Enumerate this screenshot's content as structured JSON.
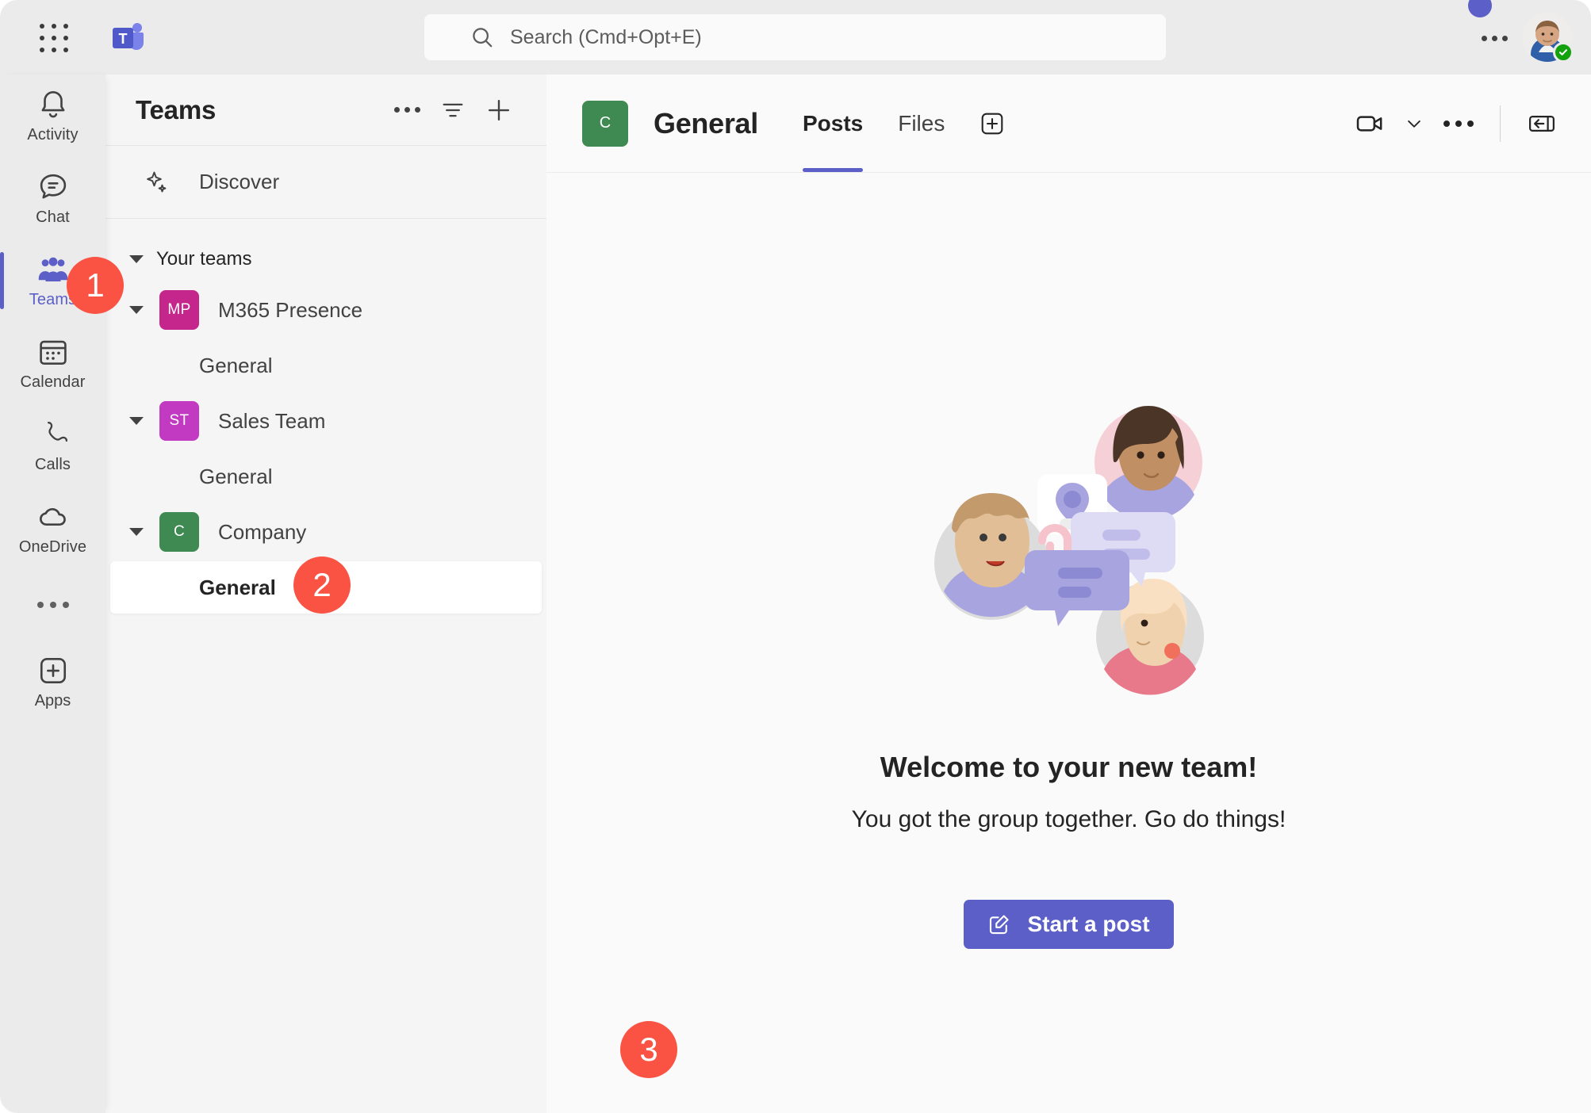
{
  "topbar": {
    "waffle_label": "app-launcher",
    "logo_label": "Microsoft Teams",
    "search": {
      "placeholder": "Search (Cmd+Opt+E)",
      "value": "",
      "icon": "search-icon"
    },
    "more_label": "Settings and more",
    "avatar_label": "Account manager",
    "presence_status": "Available"
  },
  "rail": {
    "items": [
      {
        "label": "Activity",
        "icon": "bell-icon",
        "active": false
      },
      {
        "label": "Chat",
        "icon": "chat-icon",
        "active": false
      },
      {
        "label": "Teams",
        "icon": "teams-icon",
        "active": true
      },
      {
        "label": "Calendar",
        "icon": "calendar-icon",
        "active": false
      },
      {
        "label": "Calls",
        "icon": "phone-icon",
        "active": false
      },
      {
        "label": "OneDrive",
        "icon": "cloud-icon",
        "active": false
      }
    ],
    "more_label": "More apps",
    "apps_label": "Apps"
  },
  "teams_panel": {
    "title": "Teams",
    "more_label": "Teams options",
    "filter_label": "Filter",
    "add_label": "Join or create a team",
    "discover_label": "Discover",
    "your_teams_label": "Your teams",
    "teams": [
      {
        "name": "M365 Presence",
        "initials": "MP",
        "color": "#C4268C",
        "expanded": true,
        "channels": [
          {
            "name": "General",
            "selected": false
          }
        ]
      },
      {
        "name": "Sales Team",
        "initials": "ST",
        "color": "#C239C2",
        "expanded": true,
        "channels": [
          {
            "name": "General",
            "selected": false
          }
        ]
      },
      {
        "name": "Company",
        "initials": "C",
        "color": "#3E8A52",
        "expanded": true,
        "channels": [
          {
            "name": "General",
            "selected": true
          }
        ]
      }
    ]
  },
  "channel": {
    "team_initials": "C",
    "team_color": "#3E8A52",
    "title": "General",
    "tabs": [
      {
        "label": "Posts",
        "active": true
      },
      {
        "label": "Files",
        "active": false
      }
    ],
    "add_tab_label": "Add a tab",
    "meet_label": "Meet now",
    "meet_chevron_label": "Meeting options",
    "more_label": "More options",
    "expand_label": "Open chat details"
  },
  "empty_state": {
    "illustration": "team-collaboration-illustration",
    "title": "Welcome to your new team!",
    "subtitle": "You got the group together. Go do things!",
    "start_post_label": "Start a post",
    "start_post_icon": "compose-icon"
  },
  "step_badges": [
    {
      "number": "1",
      "target": "rail-item-teams"
    },
    {
      "number": "2",
      "target": "channel-general-company"
    },
    {
      "number": "3",
      "target": "start-a-post-button"
    }
  ],
  "colors": {
    "accent": "#5B5FC7",
    "badge": "#FA5343",
    "presence_available": "#13A10E",
    "rail_bg": "#EBEBEB",
    "panel_bg": "#F5F5F5",
    "main_bg": "#FAFAFA"
  }
}
